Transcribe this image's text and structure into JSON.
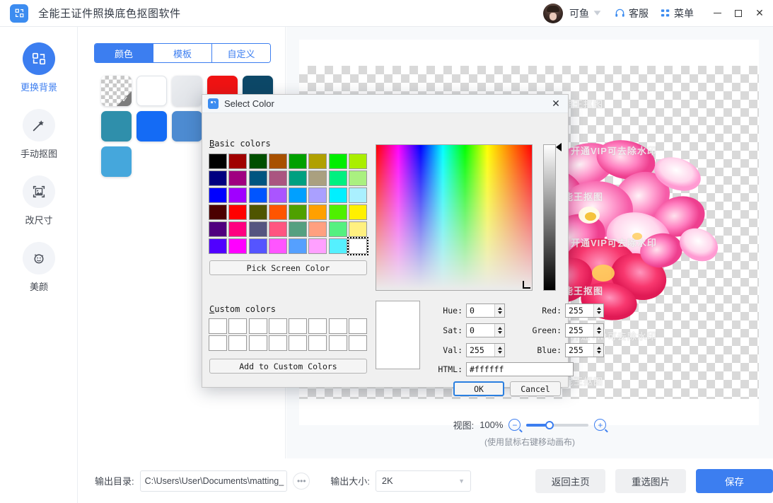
{
  "titlebar": {
    "app_title": "全能王证件照换底色抠图软件",
    "logo_icon": "app-logo-icon",
    "user_name": "可鱼",
    "user_caret_icon": "chevron-down-badge-icon",
    "support": {
      "label": "客服",
      "icon": "headset-icon"
    },
    "menu": {
      "label": "菜单",
      "icon": "grid-menu-icon"
    },
    "window": {
      "minimize_icon": "minimize-icon",
      "maximize_icon": "maximize-icon",
      "close_icon": "close-icon"
    }
  },
  "sidebar": {
    "items": [
      {
        "label": "更换背景",
        "icon": "replace-background-icon",
        "active": true
      },
      {
        "label": "手动抠图",
        "icon": "magic-wand-icon",
        "active": false
      },
      {
        "label": "改尺寸",
        "icon": "resize-image-icon",
        "active": false
      },
      {
        "label": "美颜",
        "icon": "beauty-face-icon",
        "active": false
      }
    ]
  },
  "panel": {
    "tabs": [
      {
        "label": "颜色",
        "active": true
      },
      {
        "label": "模板",
        "active": false
      },
      {
        "label": "自定义",
        "active": false
      }
    ],
    "swatches": [
      {
        "name": "transparent",
        "color": "transparent",
        "selected": true
      },
      {
        "name": "white",
        "color": "#ffffff",
        "selected": false
      },
      {
        "name": "light-gray",
        "color": "#e2e5e9",
        "selected": false
      },
      {
        "name": "red",
        "color": "#f01313",
        "selected": false
      },
      {
        "name": "dark-teal",
        "color": "#0d4868",
        "selected": false
      },
      {
        "name": "teal",
        "color": "#2f8fab",
        "selected": false
      },
      {
        "name": "blue",
        "color": "#146bf5",
        "selected": false
      },
      {
        "name": "steel-blue",
        "color": "#4d8bd1",
        "selected": false
      },
      {
        "name": "rose",
        "color": "#e1939e",
        "selected": false
      },
      {
        "name": "slate-blue",
        "color": "#5679ad",
        "selected": false
      },
      {
        "name": "sky-blue",
        "color": "#45a7dc",
        "selected": false
      }
    ]
  },
  "canvas": {
    "watermark_brand": "全能王抠图",
    "watermark_vip": "开通VIP可去除水印",
    "zoom": {
      "label": "视图:",
      "value": "100%",
      "zoom_out_icon": "zoom-out-icon",
      "zoom_in_icon": "zoom-in-icon",
      "percent": 37
    },
    "hint": "(使用鼠标右键移动画布)"
  },
  "bottombar": {
    "output_dir_label": "输出目录:",
    "output_dir_value": "C:\\Users\\User\\Documents\\matting_",
    "browse_icon": "ellipsis-icon",
    "output_size_label": "输出大小:",
    "output_size_value": "2K",
    "output_size_caret": "chevron-down-icon",
    "back_home": "返回主页",
    "reselect_image": "重选图片",
    "save": "保存"
  },
  "dialog": {
    "title": "Select Color",
    "title_icon": "color-picker-icon",
    "close_icon": "close-icon",
    "basic_colors_label": "Basic colors",
    "custom_colors_label": "Custom colors",
    "pick_screen_color": "Pick Screen Color",
    "add_to_custom_colors": "Add to Custom Colors",
    "ok": "OK",
    "cancel": "Cancel",
    "basic_colors": [
      "#000000",
      "#a00000",
      "#004f00",
      "#a85000",
      "#00a000",
      "#b0a000",
      "#00ee00",
      "#aaee00",
      "#000080",
      "#a00080",
      "#005580",
      "#aa5580",
      "#00a080",
      "#aaa080",
      "#00f080",
      "#aaf080",
      "#0000ff",
      "#a000ff",
      "#0055ff",
      "#aa55ff",
      "#00a0ff",
      "#aaa0ff",
      "#00f0ff",
      "#aaf0ff",
      "#4b0000",
      "#ff0000",
      "#4f5500",
      "#ff5500",
      "#4fa000",
      "#ffa000",
      "#4ff000",
      "#fff000",
      "#50007f",
      "#ff0080",
      "#555580",
      "#ff5580",
      "#55a080",
      "#ffa080",
      "#55f080",
      "#fff080",
      "#5000ff",
      "#ff00ff",
      "#5555ff",
      "#ff55ff",
      "#55a0ff",
      "#ffa0ff",
      "#55f0ff",
      "#ffffff"
    ],
    "selected_basic_index": 47,
    "custom_colors": [
      "#ffffff",
      "#ffffff",
      "#ffffff",
      "#ffffff",
      "#ffffff",
      "#ffffff",
      "#ffffff",
      "#ffffff",
      "#ffffff",
      "#ffffff",
      "#ffffff",
      "#ffffff",
      "#ffffff",
      "#ffffff",
      "#ffffff",
      "#ffffff"
    ],
    "preview_color": "#ffffff",
    "fields": {
      "hue": {
        "label": "Hue:",
        "value": "0"
      },
      "sat": {
        "label": "Sat:",
        "value": "0"
      },
      "val": {
        "label": "Val:",
        "value": "255"
      },
      "red": {
        "label": "Red:",
        "value": "255"
      },
      "green": {
        "label": "Green:",
        "value": "255"
      },
      "blue": {
        "label": "Blue:",
        "value": "255"
      },
      "html": {
        "label": "HTML:",
        "value": "#ffffff"
      }
    }
  },
  "colors": {
    "accent": "#3c7ef0",
    "panel_bg": "#ffffff",
    "work_bg": "#f7f9fb",
    "dialog_bg": "#f0f0f0"
  }
}
